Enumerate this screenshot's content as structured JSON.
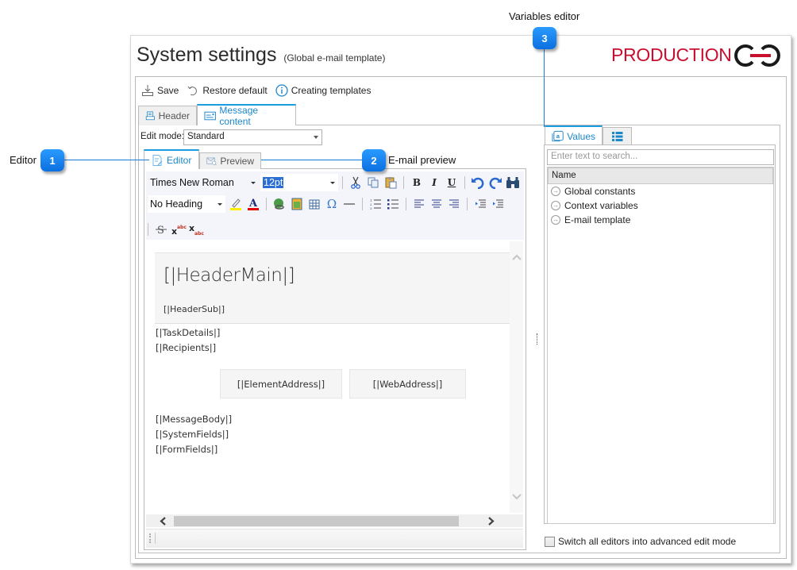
{
  "window": {
    "title": "System settings",
    "subtitle": "(Global e-mail template)",
    "logo_text": "PRODUCTION",
    "logo_color": "#c8102e"
  },
  "toolbar": {
    "save_label": "Save",
    "restore_label": "Restore default",
    "help_label": "Creating templates"
  },
  "main_tabs": [
    {
      "label": "Header",
      "active": false
    },
    {
      "label": "Message content",
      "active": true
    }
  ],
  "edit_mode": {
    "label": "Edit mode:",
    "value": "Standard"
  },
  "editor_tabs": [
    {
      "label": "Editor",
      "active": true
    },
    {
      "label": "Preview",
      "active": false
    }
  ],
  "rte_toolbar": {
    "font_name": "Times New Roman",
    "font_size": "12pt",
    "paragraph_style": "No Heading",
    "bold": "B",
    "italic": "I",
    "underline": "U",
    "omega": "Ω"
  },
  "content": {
    "header_main": "[|HeaderMain|]",
    "header_sub": "[|HeaderSub|]",
    "task_details": "[|TaskDetails|]",
    "recipients": "[|Recipients|]",
    "element_address": "[|ElementAddress|]",
    "web_address": "[|WebAddress|]",
    "message_body": "[|MessageBody|]",
    "system_fields": "[|SystemFields|]",
    "form_fields": "[|FormFields|]"
  },
  "variables_panel": {
    "tabs": [
      {
        "label": "Values",
        "active": true
      },
      {
        "label": "",
        "icon": "list-icon",
        "active": false
      }
    ],
    "search_placeholder": "Enter text to search...",
    "column_header": "Name",
    "items": [
      {
        "label": "Global constants"
      },
      {
        "label": "Context variables"
      },
      {
        "label": "E-mail template"
      }
    ]
  },
  "advanced_mode": {
    "label": "Switch all editors into advanced edit mode",
    "checked": false
  },
  "callouts": [
    {
      "number": "1",
      "label": "Editor"
    },
    {
      "number": "2",
      "label": "E-mail preview"
    },
    {
      "number": "3",
      "label": "Variables editor"
    }
  ],
  "colors": {
    "accent": "#1c9ce0",
    "callout": "#1a7ad8"
  }
}
